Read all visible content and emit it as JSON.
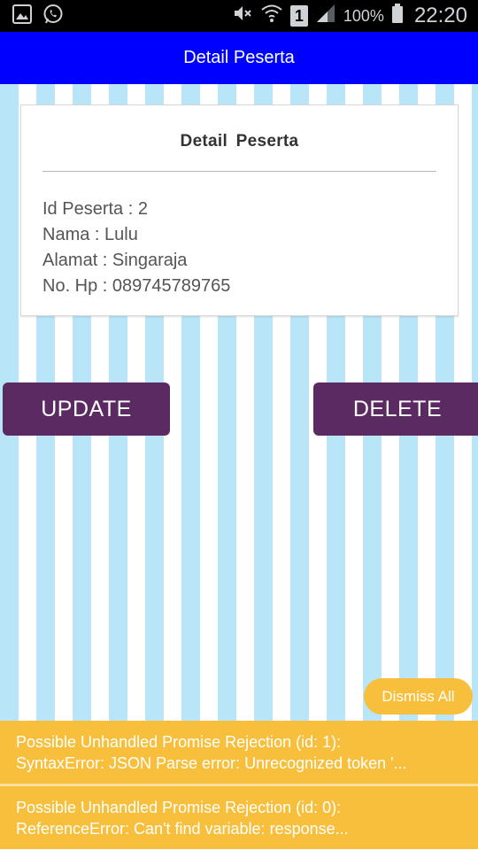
{
  "status_bar": {
    "battery_percent": "100%",
    "time": "22:20",
    "sim_slot": "1"
  },
  "app_bar": {
    "title": "Detail Peserta"
  },
  "card": {
    "title": "Detail  Peserta",
    "lines": [
      "Id Peserta : 2",
      "Nama : Lulu",
      "Alamat : Singaraja",
      "No. Hp : 089745789765"
    ]
  },
  "buttons": {
    "update": "UPDATE",
    "delete": "DELETE"
  },
  "dismiss_all": "Dismiss All",
  "warnings": [
    {
      "line1": "Possible Unhandled Promise Rejection (id: 1):",
      "line2": "SyntaxError: JSON Parse error: Unrecognized token '..."
    },
    {
      "line1": "Possible Unhandled Promise Rejection (id: 0):",
      "line2": "ReferenceError: Can't find variable: response..."
    }
  ],
  "colors": {
    "app_bar": "#0000ff",
    "button": "#5c2a63",
    "stripe": "#b8e6f8",
    "warning": "#f8bf3c"
  }
}
